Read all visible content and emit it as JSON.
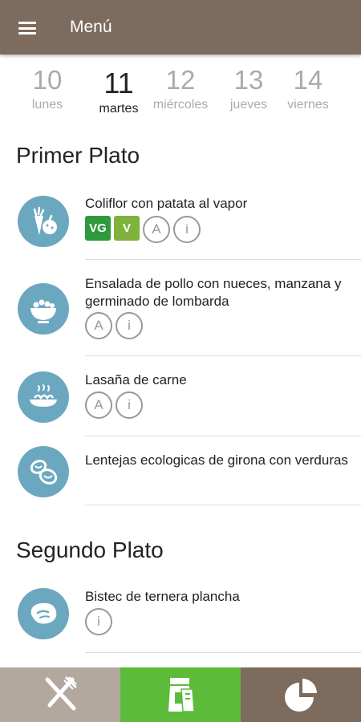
{
  "header": {
    "title": "Menú",
    "menu_icon": "hamburger-icon"
  },
  "days": [
    {
      "num": "10",
      "name": "lunes"
    },
    {
      "num": "11",
      "name": "martes",
      "active": true
    },
    {
      "num": "12",
      "name": "miércoles"
    },
    {
      "num": "13",
      "name": "jueves"
    },
    {
      "num": "14",
      "name": "viernes"
    }
  ],
  "sections": {
    "primer": {
      "title": "Primer Plato",
      "items": [
        {
          "name": "Coliflor con patata al vapor",
          "icon": "vegetables-icon",
          "badges": [
            "VG",
            "V",
            "A",
            "i"
          ]
        },
        {
          "name": "Ensalada de pollo con nueces, manzana y germinado de lombarda",
          "icon": "salad-bowl-icon",
          "badges": [
            "A",
            "i"
          ]
        },
        {
          "name": "Lasaña de carne",
          "icon": "pasta-plate-icon",
          "badges": [
            "A",
            "i"
          ]
        },
        {
          "name": "Lentejas ecologicas de girona con verduras",
          "icon": "lentils-icon",
          "badges": []
        }
      ]
    },
    "segundo": {
      "title": "Segundo Plato",
      "items": [
        {
          "name": "Bistec de ternera plancha",
          "icon": "steak-icon",
          "badges": [
            "i"
          ]
        }
      ]
    }
  },
  "colors": {
    "topbar": "#7d6b5d",
    "icon_circle": "#6ba8bf",
    "vg": "#2e9a3c",
    "v": "#7fb23c",
    "tab_menu": "#b3a89e",
    "tab_active": "#5cbb38",
    "tab_stats": "#7d6b5d"
  },
  "bottom_tabs": [
    {
      "icon": "fork-knife-icon"
    },
    {
      "icon": "food-bags-icon",
      "active": true
    },
    {
      "icon": "pie-chart-icon"
    }
  ]
}
